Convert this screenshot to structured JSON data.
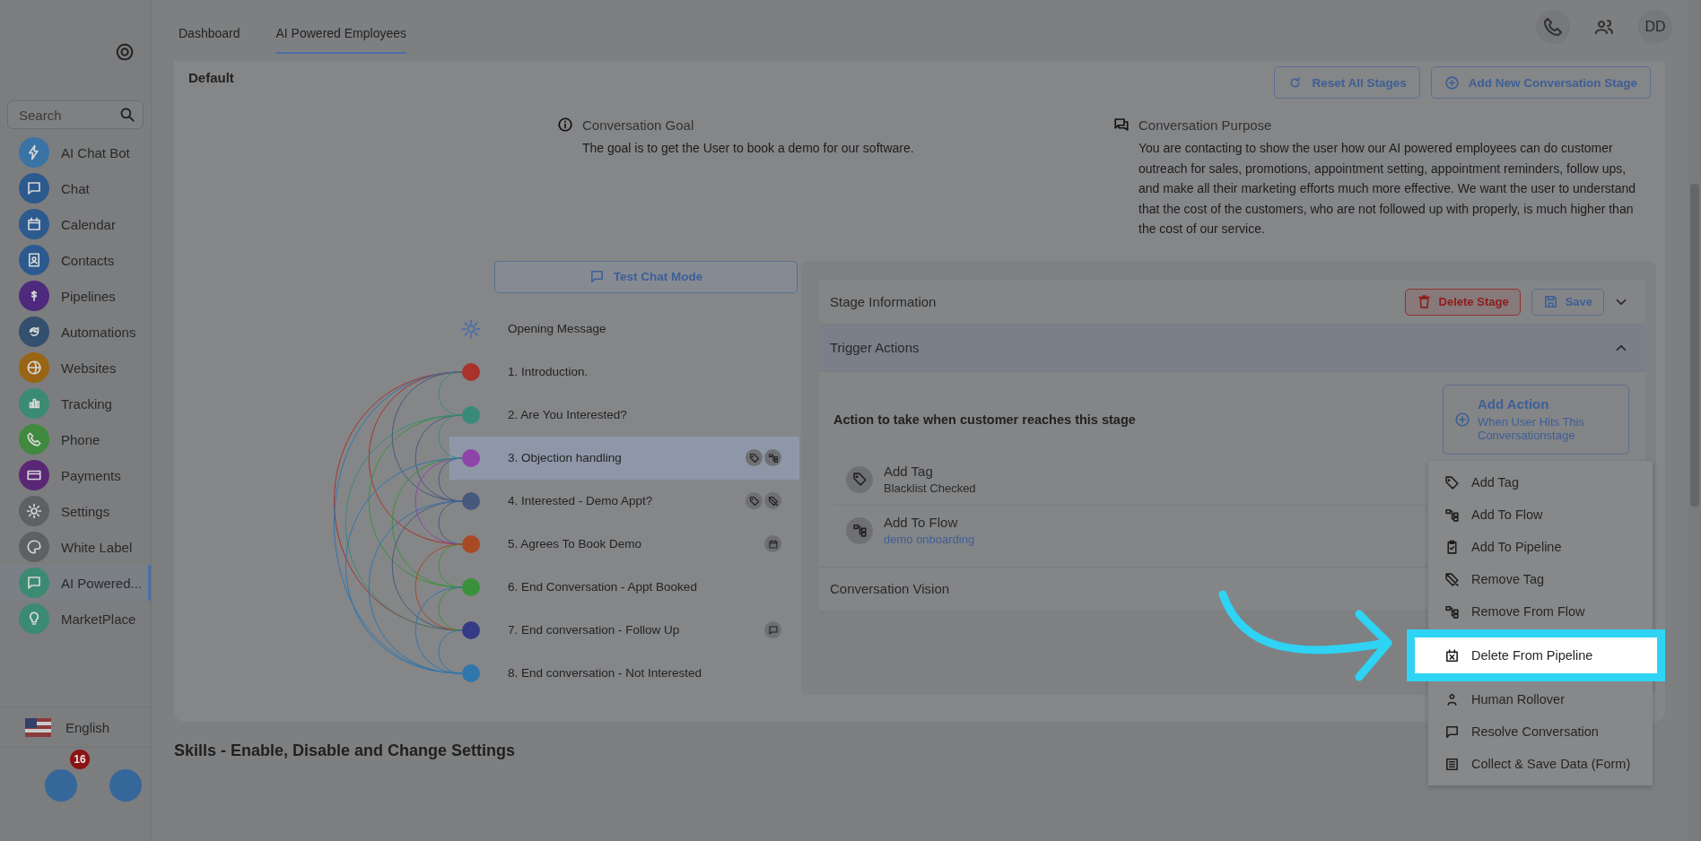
{
  "sidebar": {
    "search": {
      "placeholder": "Search"
    },
    "items": [
      {
        "label": "AI Chat Bot",
        "kind": "bolt",
        "color": "#3a73a6",
        "selected": false
      },
      {
        "label": "Chat",
        "kind": "chat",
        "color": "#2c5a8e",
        "selected": false
      },
      {
        "label": "Calendar",
        "kind": "calendar",
        "color": "#2c5a8e",
        "selected": false
      },
      {
        "label": "Contacts",
        "kind": "contact",
        "color": "#2c5a8e",
        "selected": false
      },
      {
        "label": "Pipelines",
        "kind": "dollar",
        "color": "#4e2a7e",
        "selected": false
      },
      {
        "label": "Automations",
        "kind": "sync",
        "color": "#33506e",
        "selected": false
      },
      {
        "label": "Websites",
        "kind": "globe",
        "color": "#9a6415",
        "selected": false
      },
      {
        "label": "Tracking",
        "kind": "bars",
        "color": "#3b8a72",
        "selected": false
      },
      {
        "label": "Phone",
        "kind": "phone",
        "color": "#3f8a3e",
        "selected": false
      },
      {
        "label": "Payments",
        "kind": "card",
        "color": "#5a2775",
        "selected": false
      },
      {
        "label": "Settings",
        "kind": "gear",
        "color": "#5e6063",
        "selected": false
      },
      {
        "label": "White Label",
        "kind": "palette",
        "color": "#5e6063",
        "selected": false
      },
      {
        "label": "AI Powered...",
        "kind": "chat",
        "color": "#3b8a72",
        "selected": true
      },
      {
        "label": "MarketPlace",
        "kind": "bulb",
        "color": "#3b8a72",
        "selected": false
      }
    ],
    "language": "English",
    "notification_count": "16"
  },
  "tabs": [
    {
      "label": "Dashboard",
      "selected": false
    },
    {
      "label": "AI Powered Employees",
      "selected": true
    }
  ],
  "avatar": "DD",
  "section_title": "Default",
  "header_buttons": [
    {
      "kind": "reset",
      "label": "Reset All Stages"
    },
    {
      "kind": "plus",
      "label": "Add New Conversation Stage"
    }
  ],
  "goal": {
    "title": "Conversation Goal",
    "text": "The goal is to get the User to book a demo for our software."
  },
  "purpose": {
    "title": "Conversation Purpose",
    "text": "You are contacting to show the user how our AI powered employees can do customer outreach for sales, promotions, appointment setting, appointment reminders, follow ups, and make all their marketing efforts much more effective. We want the user to understand that the cost of the customers, who are not followed up with properly, is much higher than the cost of our service."
  },
  "test_chat_button": "Test Chat Mode",
  "stages": [
    {
      "kind": "opening",
      "label": "Opening Message",
      "selected": false
    },
    {
      "kind": "stage",
      "label": "1. Introduction.",
      "color": "#a8332c",
      "selected": false
    },
    {
      "kind": "stage",
      "label": "2. Are You Interested?",
      "color": "#3a8a7a",
      "selected": false
    },
    {
      "kind": "stage",
      "label": "3. Objection handling",
      "color": "#8e44a8",
      "selected": true,
      "badges": [
        {
          "kind": "tag"
        },
        {
          "kind": "flow"
        }
      ]
    },
    {
      "kind": "stage",
      "label": "4. Interested - Demo Appt?",
      "color": "#47597e",
      "selected": false,
      "badges": [
        {
          "kind": "tag"
        },
        {
          "kind": "tag-off"
        }
      ]
    },
    {
      "kind": "stage",
      "label": "5. Agrees To Book Demo",
      "color": "#a84a26",
      "selected": false,
      "badges": [
        {
          "kind": "calendar"
        }
      ]
    },
    {
      "kind": "stage",
      "label": "6. End Conversation - Appt Booked",
      "color": "#3a913c",
      "selected": false
    },
    {
      "kind": "stage",
      "label": "7. End conversation - Follow Up",
      "color": "#363b86",
      "selected": false,
      "badges": [
        {
          "kind": "chat"
        }
      ]
    },
    {
      "kind": "stage",
      "label": "8. End conversation - Not Interested",
      "color": "#2f76ad",
      "selected": false
    }
  ],
  "stage_panel": {
    "sections": [
      {
        "title": "Stage Information",
        "expanded": false
      },
      {
        "title": "Trigger Actions",
        "expanded": true
      },
      {
        "title": "Conversation Vision",
        "expanded": false
      }
    ],
    "delete_button": "Delete Stage",
    "save_button": "Save",
    "actions_heading": "Action to take when customer reaches this stage",
    "add_action": {
      "title": "Add Action",
      "subtitle": "When User Hits This Conversationstage"
    },
    "actions": [
      {
        "kind": "tag",
        "title": "Add Tag",
        "detail": "Blacklist Checked",
        "link": false
      },
      {
        "kind": "flow",
        "title": "Add To Flow",
        "detail": "demo onboarding",
        "link": true
      }
    ]
  },
  "action_menu": [
    {
      "kind": "tag",
      "label": "Add Tag",
      "selected": false
    },
    {
      "kind": "flow",
      "label": "Add To Flow",
      "selected": false
    },
    {
      "kind": "clipboard",
      "label": "Add To Pipeline",
      "selected": false
    },
    {
      "kind": "tag-off",
      "label": "Remove Tag",
      "selected": false
    },
    {
      "kind": "flow",
      "label": "Remove From Flow",
      "selected": false
    },
    {
      "kind": "calendar-x",
      "label": "Delete From Pipeline",
      "selected": true
    },
    {
      "kind": "person",
      "label": "Human Rollover",
      "selected": false
    },
    {
      "kind": "chat",
      "label": "Resolve Conversation",
      "selected": false
    },
    {
      "kind": "list",
      "label": "Collect & Save Data (Form)",
      "selected": false
    }
  ],
  "skills_heading": "Skills - Enable, Disable and Change Settings"
}
